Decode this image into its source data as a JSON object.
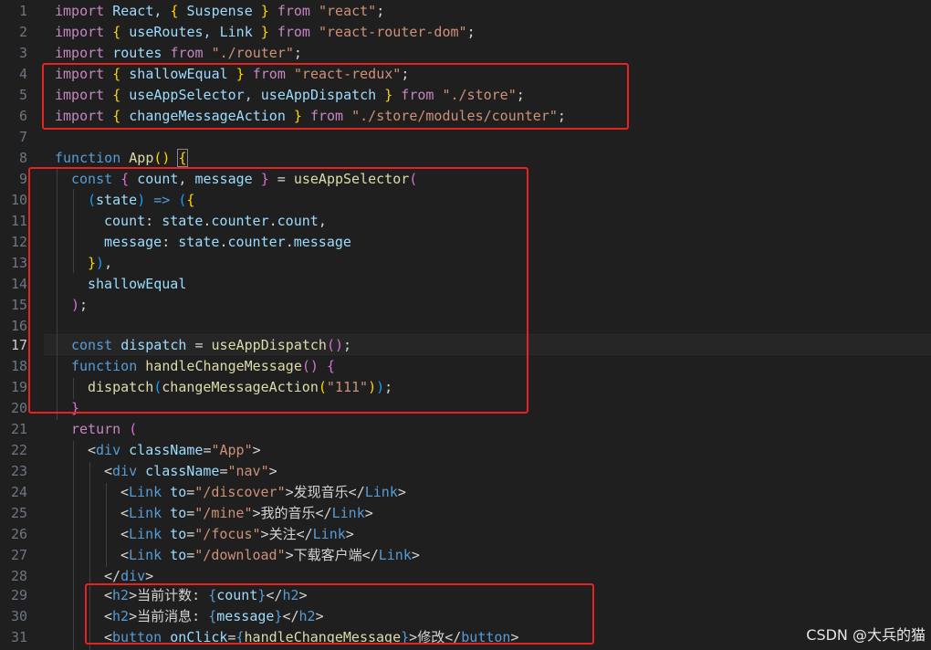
{
  "editor": {
    "active_line": 17,
    "line_numbers": [
      "1",
      "2",
      "3",
      "4",
      "5",
      "6",
      "7",
      "8",
      "9",
      "10",
      "11",
      "12",
      "13",
      "14",
      "15",
      "16",
      "17",
      "18",
      "19",
      "20",
      "21",
      "22",
      "23",
      "24",
      "25",
      "26",
      "27",
      "28",
      "29",
      "30",
      "31"
    ]
  },
  "code": {
    "l1_a": "import",
    "l1_b": " React, ",
    "l1_c": "{",
    "l1_d": " Suspense ",
    "l1_e": "}",
    "l1_f": " from ",
    "l1_g": "\"react\"",
    "l1_h": ";",
    "l2_a": "import",
    "l2_b": " ",
    "l2_c": "{",
    "l2_d": " useRoutes, Link ",
    "l2_e": "}",
    "l2_f": " from ",
    "l2_g": "\"react-router-dom\"",
    "l2_h": ";",
    "l3_a": "import",
    "l3_b": " routes ",
    "l3_c": "from",
    "l3_d": " ",
    "l3_e": "\"./router\"",
    "l3_f": ";",
    "l4_a": "import",
    "l4_b": " ",
    "l4_c": "{",
    "l4_d": " shallowEqual ",
    "l4_e": "}",
    "l4_f": " from ",
    "l4_g": "\"react-redux\"",
    "l4_h": ";",
    "l5_a": "import",
    "l5_b": " ",
    "l5_c": "{",
    "l5_d": " useAppSelector, useAppDispatch ",
    "l5_e": "}",
    "l5_f": " from ",
    "l5_g": "\"./store\"",
    "l5_h": ";",
    "l6_a": "import",
    "l6_b": " ",
    "l6_c": "{",
    "l6_d": " changeMessageAction ",
    "l6_e": "}",
    "l6_f": " from ",
    "l6_g": "\"./store/modules/counter\"",
    "l6_h": ";",
    "l8_a": "function",
    "l8_b": " ",
    "l8_c": "App",
    "l8_d": "(",
    ")": ")",
    "l8_e": ")",
    "l8_f": " ",
    "l8_g": "{",
    "l9_a": "const",
    "l9_b": " ",
    "l9_c": "{",
    "l9_d": " count",
    "l9_e": ", ",
    "l9_f": "message",
    "l9_g": " ",
    "l9_h": "}",
    "l9_i": " = ",
    "l9_j": "useAppSelector",
    "l9_k": "(",
    "l10_a": "(",
    "l10_b": "state",
    "l10_c": ")",
    "l10_d": " => ",
    "l10_e": "(",
    "l10_f": "{",
    "l11_a": "count",
    "l11_b": ": ",
    "l11_c": "state",
    "l11_d": ".",
    "l11_e": "counter",
    "l11_f": ".",
    "l11_g": "count",
    "l11_h": ",",
    "l12_a": "message",
    "l12_b": ": ",
    "l12_c": "state",
    "l12_d": ".",
    "l12_e": "counter",
    "l12_f": ".",
    "l12_g": "message",
    "l13_a": "}",
    "l13_b": ")",
    "l13_c": ",",
    "l14_a": "shallowEqual",
    "l15_a": ")",
    "l15_b": ";",
    "l17_a": "const",
    "l17_b": " ",
    "l17_c": "dispatch",
    "l17_d": " = ",
    "l17_e": "useAppDispatch",
    "l17_f": "(",
    "l17_g": ")",
    "l17_h": ";",
    "l18_a": "function",
    "l18_b": " ",
    "l18_c": "handleChangeMessage",
    "l18_d": "(",
    "l18_e": ")",
    "l18_f": " ",
    "l18_g": "{",
    "l19_a": "dispatch",
    "l19_b": "(",
    "l19_c": "changeMessageAction",
    "l19_d": "(",
    "l19_e": "\"111\"",
    "l19_f": ")",
    "l19_g": ")",
    "l19_h": ";",
    "l20_a": "}",
    "l21_a": "return",
    "l21_b": " ",
    "l21_c": "(",
    "l22_a": "<",
    "l22_b": "div",
    "l22_c": " className",
    "l22_d": "=",
    "l22_e": "\"App\"",
    "l22_f": ">",
    "l23_a": "<",
    "l23_b": "div",
    "l23_c": " className",
    "l23_d": "=",
    "l23_e": "\"nav\"",
    "l23_f": ">",
    "l24_a": "<",
    "l24_b": "Link",
    "l24_c": " to",
    "l24_d": "=",
    "l24_e": "\"/discover\"",
    "l24_f": ">",
    "l24_g": "发现音乐",
    "l24_h": "</",
    "l24_i": "Link",
    "l24_j": ">",
    "l25_a": "<",
    "l25_b": "Link",
    "l25_c": " to",
    "l25_d": "=",
    "l25_e": "\"/mine\"",
    "l25_f": ">",
    "l25_g": "我的音乐",
    "l25_h": "</",
    "l25_i": "Link",
    "l25_j": ">",
    "l26_a": "<",
    "l26_b": "Link",
    "l26_c": " to",
    "l26_d": "=",
    "l26_e": "\"/focus\"",
    "l26_f": ">",
    "l26_g": "关注",
    "l26_h": "</",
    "l26_i": "Link",
    "l26_j": ">",
    "l27_a": "<",
    "l27_b": "Link",
    "l27_c": " to",
    "l27_d": "=",
    "l27_e": "\"/download\"",
    "l27_f": ">",
    "l27_g": "下载客户端",
    "l27_h": "</",
    "l27_i": "Link",
    "l27_j": ">",
    "l28_a": "</",
    "l28_b": "div",
    "l28_c": ">",
    "l29_a": "<",
    "l29_b": "h2",
    "l29_c": ">",
    "l29_d": "当前计数: ",
    "l29_e": "{",
    "l29_f": "count",
    "l29_g": "}",
    "l29_h": "</",
    "l29_i": "h2",
    "l29_j": ">",
    "l30_a": "<",
    "l30_b": "h2",
    "l30_c": ">",
    "l30_d": "当前消息: ",
    "l30_e": "{",
    "l30_f": "message",
    "l30_g": "}",
    "l30_h": "</",
    "l30_i": "h2",
    "l30_j": ">",
    "l31_a": "<",
    "l31_b": "button",
    "l31_c": " onClick",
    "l31_d": "=",
    "l31_e": "{",
    "l31_f": "handleChangeMessage",
    "l31_g": "}",
    "l31_h": ">",
    "l31_i": "修改",
    "l31_j": "</",
    "l31_k": "button",
    "l31_l": ">"
  },
  "watermark": "CSDN @大兵的猫",
  "colors": {
    "highlight_box": "#e52421",
    "background": "#1f1f1f"
  }
}
